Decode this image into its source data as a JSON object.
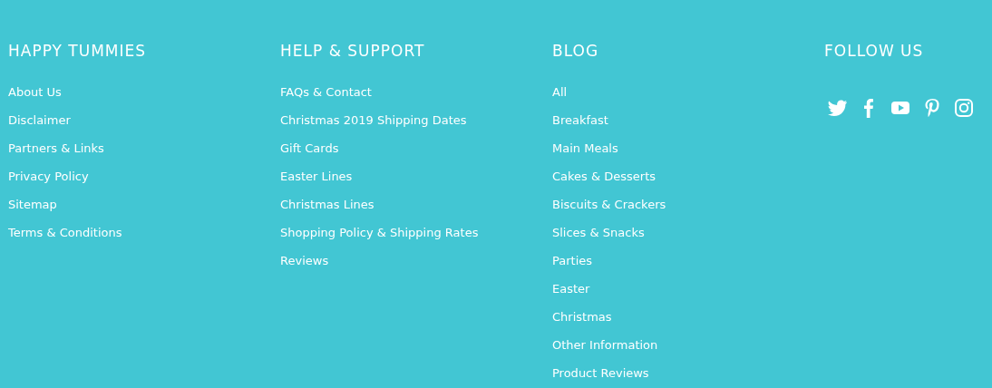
{
  "columns": [
    {
      "heading": "HAPPY TUMMIES",
      "links": [
        "About Us",
        "Disclaimer",
        "Partners & Links",
        "Privacy Policy",
        "Sitemap",
        "Terms & Conditions"
      ]
    },
    {
      "heading": "HELP & SUPPORT",
      "links": [
        "FAQs & Contact",
        "Christmas 2019 Shipping Dates",
        "Gift Cards",
        "Easter Lines",
        "Christmas Lines",
        "Shopping Policy & Shipping Rates",
        "Reviews"
      ]
    },
    {
      "heading": "BLOG",
      "links": [
        "All",
        "Breakfast",
        "Main Meals",
        "Cakes & Desserts",
        "Biscuits & Crackers",
        "Slices & Snacks",
        "Parties",
        "Easter",
        "Christmas",
        "Other Information",
        "Product Reviews"
      ]
    }
  ],
  "follow": {
    "heading": "FOLLOW US",
    "icons": [
      {
        "kind": "bird"
      },
      {
        "kind": "f"
      },
      {
        "kind": "play"
      },
      {
        "kind": "pin"
      },
      {
        "kind": "camera"
      }
    ]
  }
}
